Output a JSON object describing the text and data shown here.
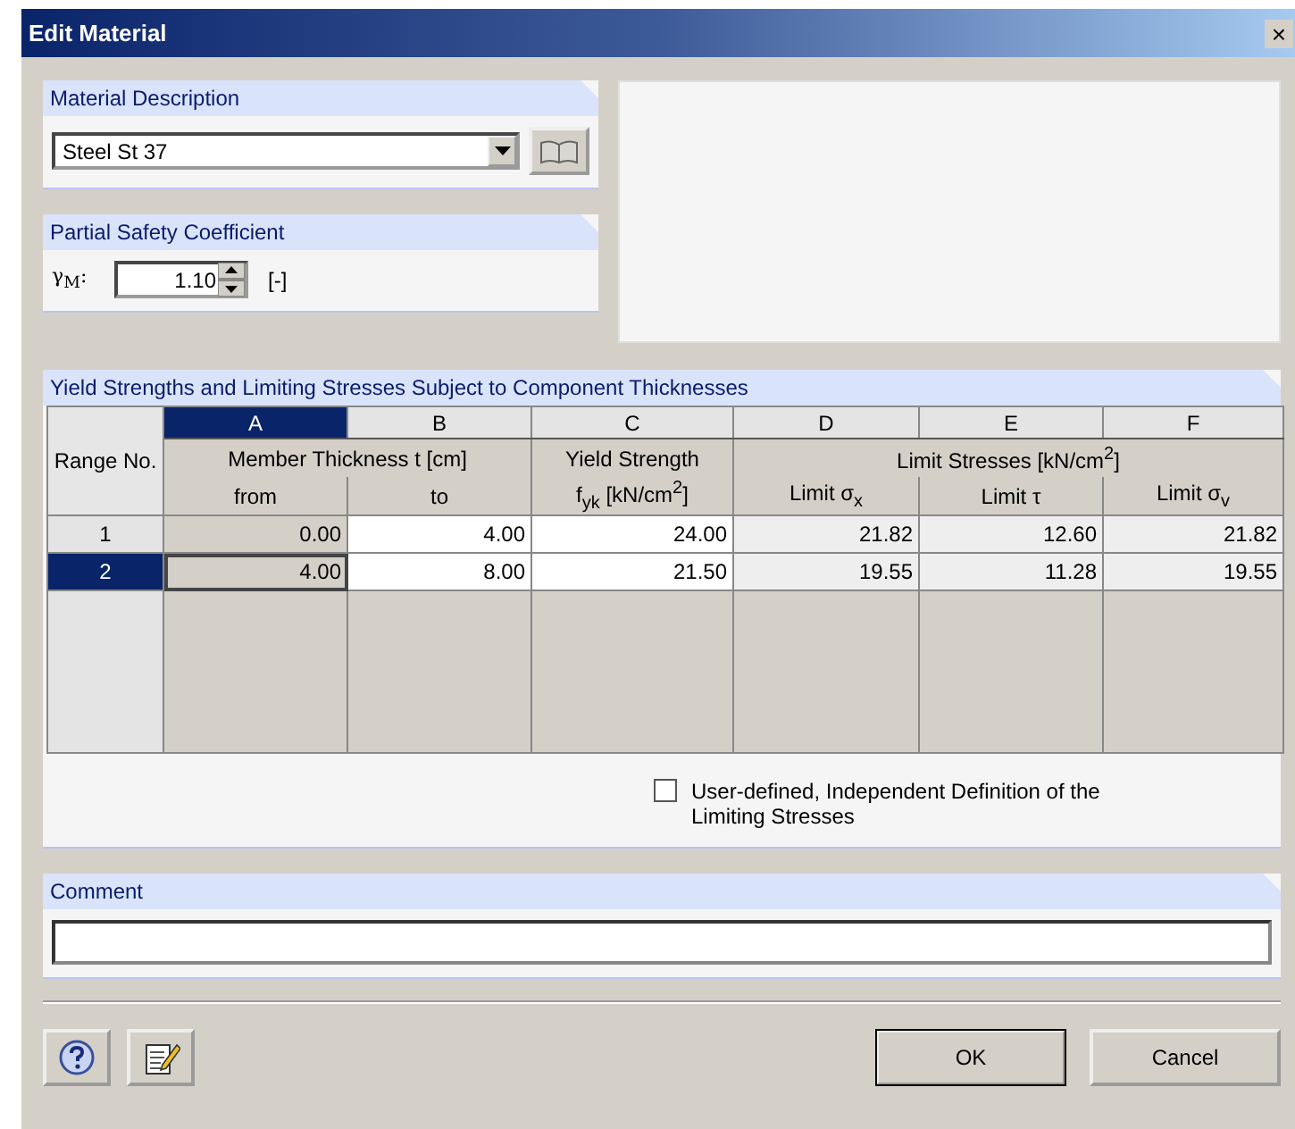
{
  "window": {
    "title": "Edit Material",
    "close": "×"
  },
  "material_description": {
    "title": "Material Description",
    "value": "Steel St 37"
  },
  "partial_safety": {
    "title": "Partial Safety Coefficient",
    "label": "γ$_{M}$:",
    "value": "1.10",
    "unit": "[-]"
  },
  "yield_table": {
    "title": "Yield Strengths and Limiting Stresses Subject to Component Thicknesses",
    "range_header": "Range No.",
    "columns": [
      {
        "letter": "A",
        "selected": true,
        "kind": "readonly"
      },
      {
        "letter": "B",
        "selected": false,
        "kind": "input"
      },
      {
        "letter": "C",
        "selected": false,
        "kind": "input"
      },
      {
        "letter": "D",
        "selected": false,
        "kind": "computed"
      },
      {
        "letter": "E",
        "selected": false,
        "kind": "computed"
      },
      {
        "letter": "F",
        "selected": false,
        "kind": "computed"
      }
    ],
    "header_groups": [
      {
        "label": "Member Thickness t [cm]",
        "subheaders": [
          "from",
          "to"
        ]
      },
      {
        "label": "Yield Strength",
        "subheaders": [
          "f$_{yk}$ [kN/cm$^{2}$]"
        ]
      },
      {
        "label": "Limit Stresses [kN/cm$^{2}$]",
        "subheaders": [
          "Limit σ$_{x}$",
          "Limit τ",
          "Limit σ$_{v}$"
        ]
      }
    ],
    "rows": [
      {
        "label": "1",
        "selected": false,
        "cells": [
          "0.00",
          "4.00",
          "24.00",
          "21.82",
          "12.60",
          "21.82"
        ]
      },
      {
        "label": "2",
        "selected": true,
        "cells": [
          "4.00",
          "8.00",
          "21.50",
          "19.55",
          "11.28",
          "19.55"
        ]
      }
    ],
    "checkbox": {
      "label": "User-defined, Independent Definition of the Limiting Stresses",
      "checked": false
    }
  },
  "comment": {
    "title": "Comment"
  },
  "buttons": [
    "OK",
    "Cancel"
  ]
}
